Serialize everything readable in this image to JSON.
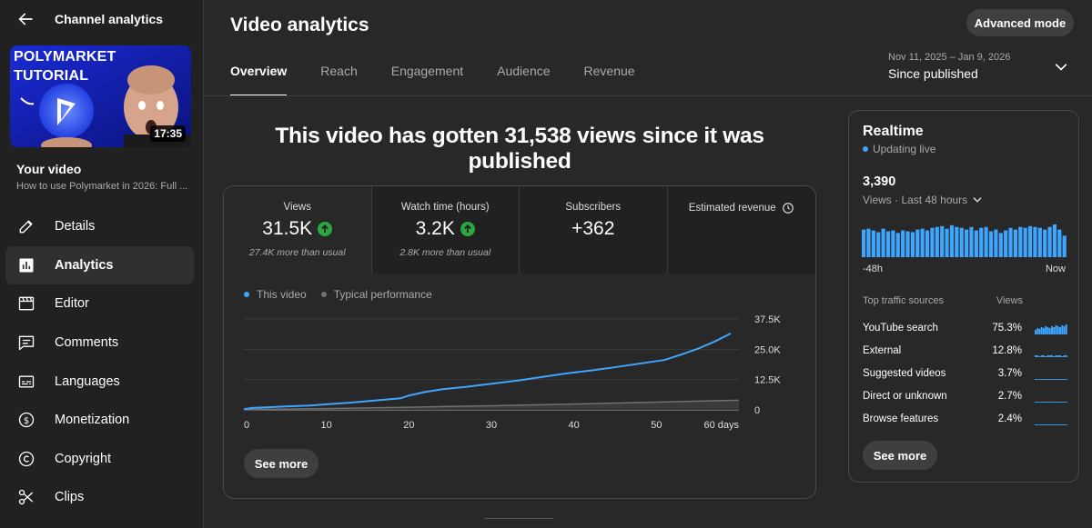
{
  "sidebar": {
    "title": "Channel analytics",
    "thumbnail": {
      "line1": "POLYMARKET",
      "line2": "TUTORIAL",
      "duration": "17:35"
    },
    "your_video_label": "Your video",
    "video_title": "How to use Polymarket in 2026: Full ...",
    "items": [
      {
        "label": "Details",
        "icon": "pencil-icon"
      },
      {
        "label": "Analytics",
        "icon": "analytics-icon"
      },
      {
        "label": "Editor",
        "icon": "editor-icon"
      },
      {
        "label": "Comments",
        "icon": "comments-icon"
      },
      {
        "label": "Languages",
        "icon": "languages-icon"
      },
      {
        "label": "Monetization",
        "icon": "monetization-icon"
      },
      {
        "label": "Copyright",
        "icon": "copyright-icon"
      },
      {
        "label": "Clips",
        "icon": "clips-icon"
      }
    ]
  },
  "header": {
    "title": "Video analytics",
    "advanced_mode": "Advanced mode",
    "tabs": [
      "Overview",
      "Reach",
      "Engagement",
      "Audience",
      "Revenue"
    ],
    "date_range": "Nov 11, 2025 – Jan 9, 2026",
    "period": "Since published"
  },
  "headline": "This video has gotten 31,538 views since it was published",
  "metrics": [
    {
      "label": "Views",
      "value": "31.5K",
      "sub": "27.4K more than usual",
      "trend": "up"
    },
    {
      "label": "Watch time (hours)",
      "value": "3.2K",
      "sub": "2.8K more than usual",
      "trend": "up"
    },
    {
      "label": "Subscribers",
      "value": "+362",
      "sub": ""
    },
    {
      "label": "Estimated revenue",
      "value": "",
      "sub": ""
    }
  ],
  "legend": {
    "this_video": "This video",
    "typical": "Typical performance"
  },
  "see_more": "See more",
  "colors": {
    "accent": "#3ea6ff",
    "up": "#2ba640",
    "typical": "#717171"
  },
  "chart_data": {
    "type": "line",
    "xlabel": "",
    "x_ticks": [
      "0",
      "10",
      "20",
      "30",
      "40",
      "50",
      "60 days"
    ],
    "y_ticks": [
      "0",
      "12.5K",
      "25.0K",
      "37.5K"
    ],
    "ylim": [
      0,
      37500
    ],
    "xlim": [
      0,
      60
    ],
    "series": [
      {
        "name": "This video",
        "x": [
          0,
          1,
          3,
          5,
          8,
          10,
          13,
          16,
          19,
          20,
          22,
          24,
          27,
          30,
          33,
          36,
          39,
          42,
          45,
          48,
          51,
          53,
          55,
          57,
          59
        ],
        "y": [
          300,
          800,
          1100,
          1400,
          1800,
          2300,
          3000,
          3900,
          4800,
          5900,
          7400,
          8500,
          9500,
          10800,
          12000,
          13500,
          15000,
          16200,
          17600,
          19100,
          20600,
          22800,
          25200,
          28100,
          31500
        ]
      },
      {
        "name": "Typical performance",
        "x": [
          0,
          10,
          20,
          30,
          40,
          50,
          60
        ],
        "y": [
          150,
          500,
          1100,
          1700,
          2400,
          3200,
          4000
        ]
      }
    ]
  },
  "realtime": {
    "title": "Realtime",
    "status": "Updating live",
    "count": "3,390",
    "period": "Views · Last 48 hours",
    "axis_start": "-48h",
    "axis_end": "Now",
    "bars": [
      64,
      66,
      62,
      58,
      66,
      60,
      62,
      56,
      62,
      60,
      58,
      64,
      66,
      62,
      68,
      70,
      72,
      66,
      74,
      70,
      68,
      64,
      70,
      62,
      68,
      70,
      60,
      64,
      56,
      62,
      68,
      64,
      70,
      68,
      72,
      70,
      68,
      64,
      70,
      76,
      64,
      50
    ],
    "sources_header": "Top traffic sources",
    "views_header": "Views",
    "sources": [
      {
        "name": "YouTube search",
        "pct": "75.3%",
        "spark": [
          5,
          7,
          6,
          8,
          7,
          9,
          8,
          7,
          9,
          8,
          10,
          9,
          8,
          10,
          9,
          11
        ]
      },
      {
        "name": "External",
        "pct": "12.8%",
        "spark": [
          2,
          2,
          1,
          2,
          2,
          1,
          2,
          2,
          2,
          1,
          2,
          2,
          2,
          1,
          2,
          2
        ]
      },
      {
        "name": "Suggested videos",
        "pct": "3.7%",
        "spark": [
          1,
          1,
          1,
          1,
          1,
          1,
          1,
          1,
          1,
          1,
          1,
          1,
          1,
          1,
          1,
          1
        ]
      },
      {
        "name": "Direct or unknown",
        "pct": "2.7%",
        "spark": [
          1,
          1,
          1,
          1,
          1,
          1,
          1,
          1,
          1,
          1,
          1,
          1,
          1,
          1,
          1,
          1
        ]
      },
      {
        "name": "Browse features",
        "pct": "2.4%",
        "spark": [
          1,
          1,
          1,
          1,
          1,
          1,
          1,
          1,
          1,
          1,
          1,
          1,
          1,
          1,
          1,
          1
        ]
      }
    ],
    "see_more": "See more"
  }
}
